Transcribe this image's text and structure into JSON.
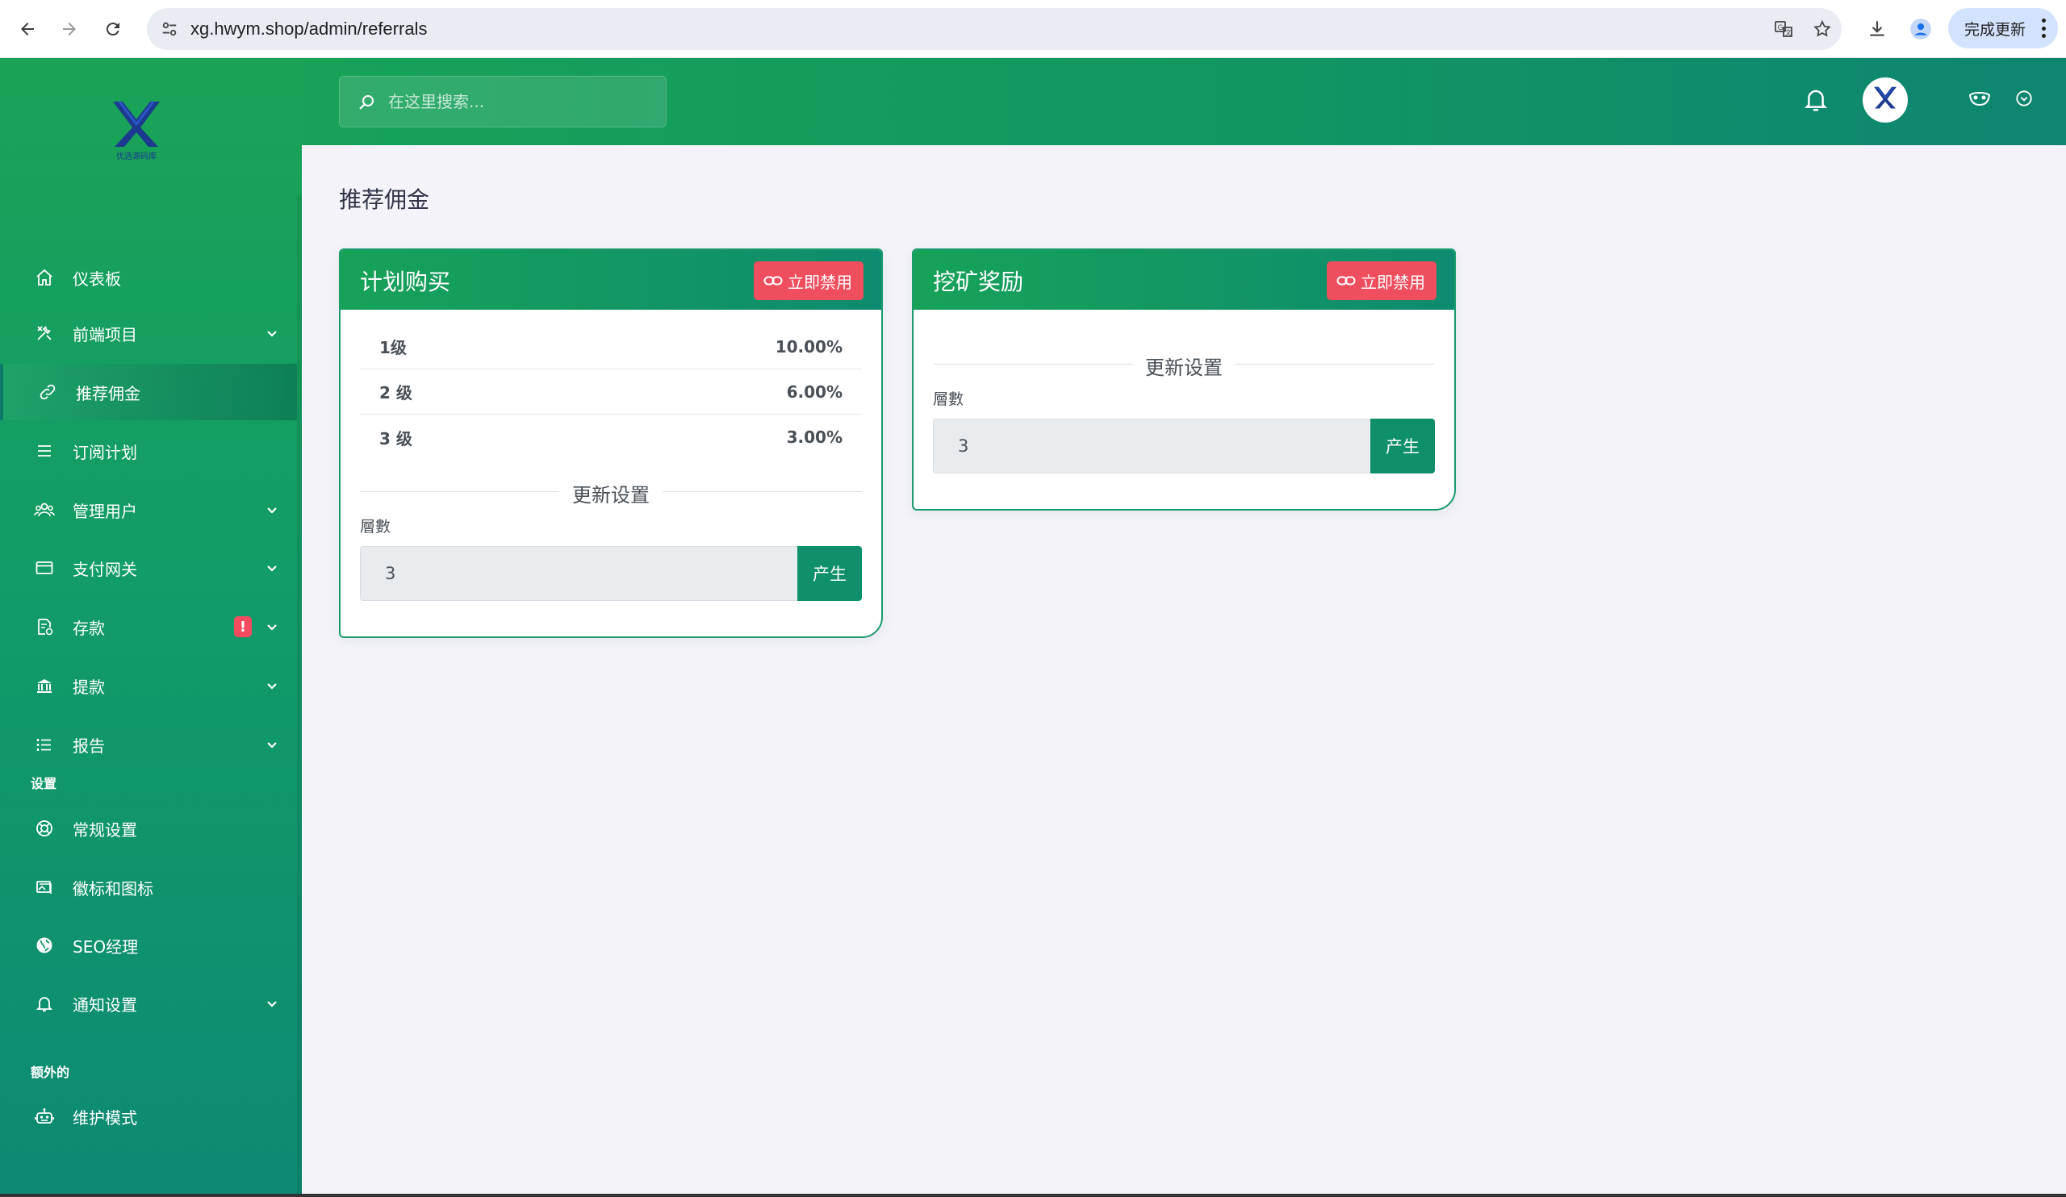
{
  "browser": {
    "url": "xg.hwym.shop/admin/referrals",
    "update_label": "完成更新"
  },
  "sidebar": {
    "items": [
      {
        "label": "仪表板",
        "icon": "home-icon"
      },
      {
        "label": "前端项目",
        "icon": "tools-icon",
        "expandable": true
      },
      {
        "label": "推荐佣金",
        "icon": "link-icon",
        "active": true
      },
      {
        "label": "订阅计划",
        "icon": "list-icon"
      },
      {
        "label": "管理用户",
        "icon": "users-icon",
        "expandable": true
      },
      {
        "label": "支付网关",
        "icon": "credit-card-icon",
        "expandable": true
      },
      {
        "label": "存款",
        "icon": "deposit-icon",
        "expandable": true,
        "badge": "!"
      },
      {
        "label": "提款",
        "icon": "bank-icon",
        "expandable": true
      },
      {
        "label": "报告",
        "icon": "report-list-icon",
        "expandable": true
      }
    ],
    "section_settings": "设置",
    "settings_items": [
      {
        "label": "常规设置",
        "icon": "lifebuoy-icon"
      },
      {
        "label": "徽标和图标",
        "icon": "images-icon"
      },
      {
        "label": "SEO经理",
        "icon": "globe-icon"
      },
      {
        "label": "通知设置",
        "icon": "bell-icon",
        "expandable": true
      }
    ],
    "section_extra": "额外的",
    "extra_items": [
      {
        "label": "维护模式",
        "icon": "robot-icon"
      }
    ]
  },
  "header": {
    "search_placeholder": "在这里搜索..."
  },
  "page": {
    "title": "推荐佣金"
  },
  "cards": {
    "plan": {
      "title": "计划购买",
      "disable_label": "立即禁用",
      "levels": [
        {
          "level": "1级",
          "value": "10.00%"
        },
        {
          "level": "2 级",
          "value": "6.00%"
        },
        {
          "level": "3 级",
          "value": "3.00%"
        }
      ],
      "update_title": "更新设置",
      "field_label": "層數",
      "field_value": "3",
      "submit_label": "产生"
    },
    "mining": {
      "title": "挖矿奖励",
      "disable_label": "立即禁用",
      "update_title": "更新设置",
      "field_label": "層數",
      "field_value": "3",
      "submit_label": "产生"
    }
  },
  "colors": {
    "primary_green": "#17a258",
    "teal": "#0d8a73",
    "danger": "#ef4e5f"
  }
}
